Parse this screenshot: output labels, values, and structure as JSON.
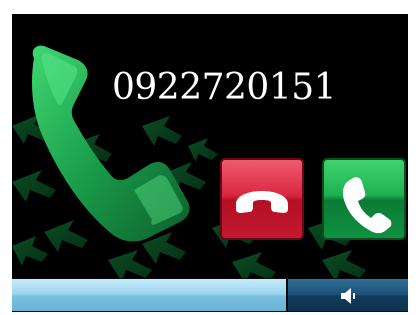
{
  "call": {
    "phone_number": "0922720151"
  },
  "buttons": {
    "hangup_icon": "phone-hangup-icon",
    "answer_icon": "phone-answer-icon"
  },
  "bottom_bar": {
    "speaker_icon": "speaker-icon"
  },
  "colors": {
    "background": "#000000",
    "hangup": "#d9283f",
    "answer": "#1fb051",
    "accent_green": "#1f9a4a",
    "volume_track": "#9ed6ee",
    "speaker_button": "#1b4f75"
  }
}
